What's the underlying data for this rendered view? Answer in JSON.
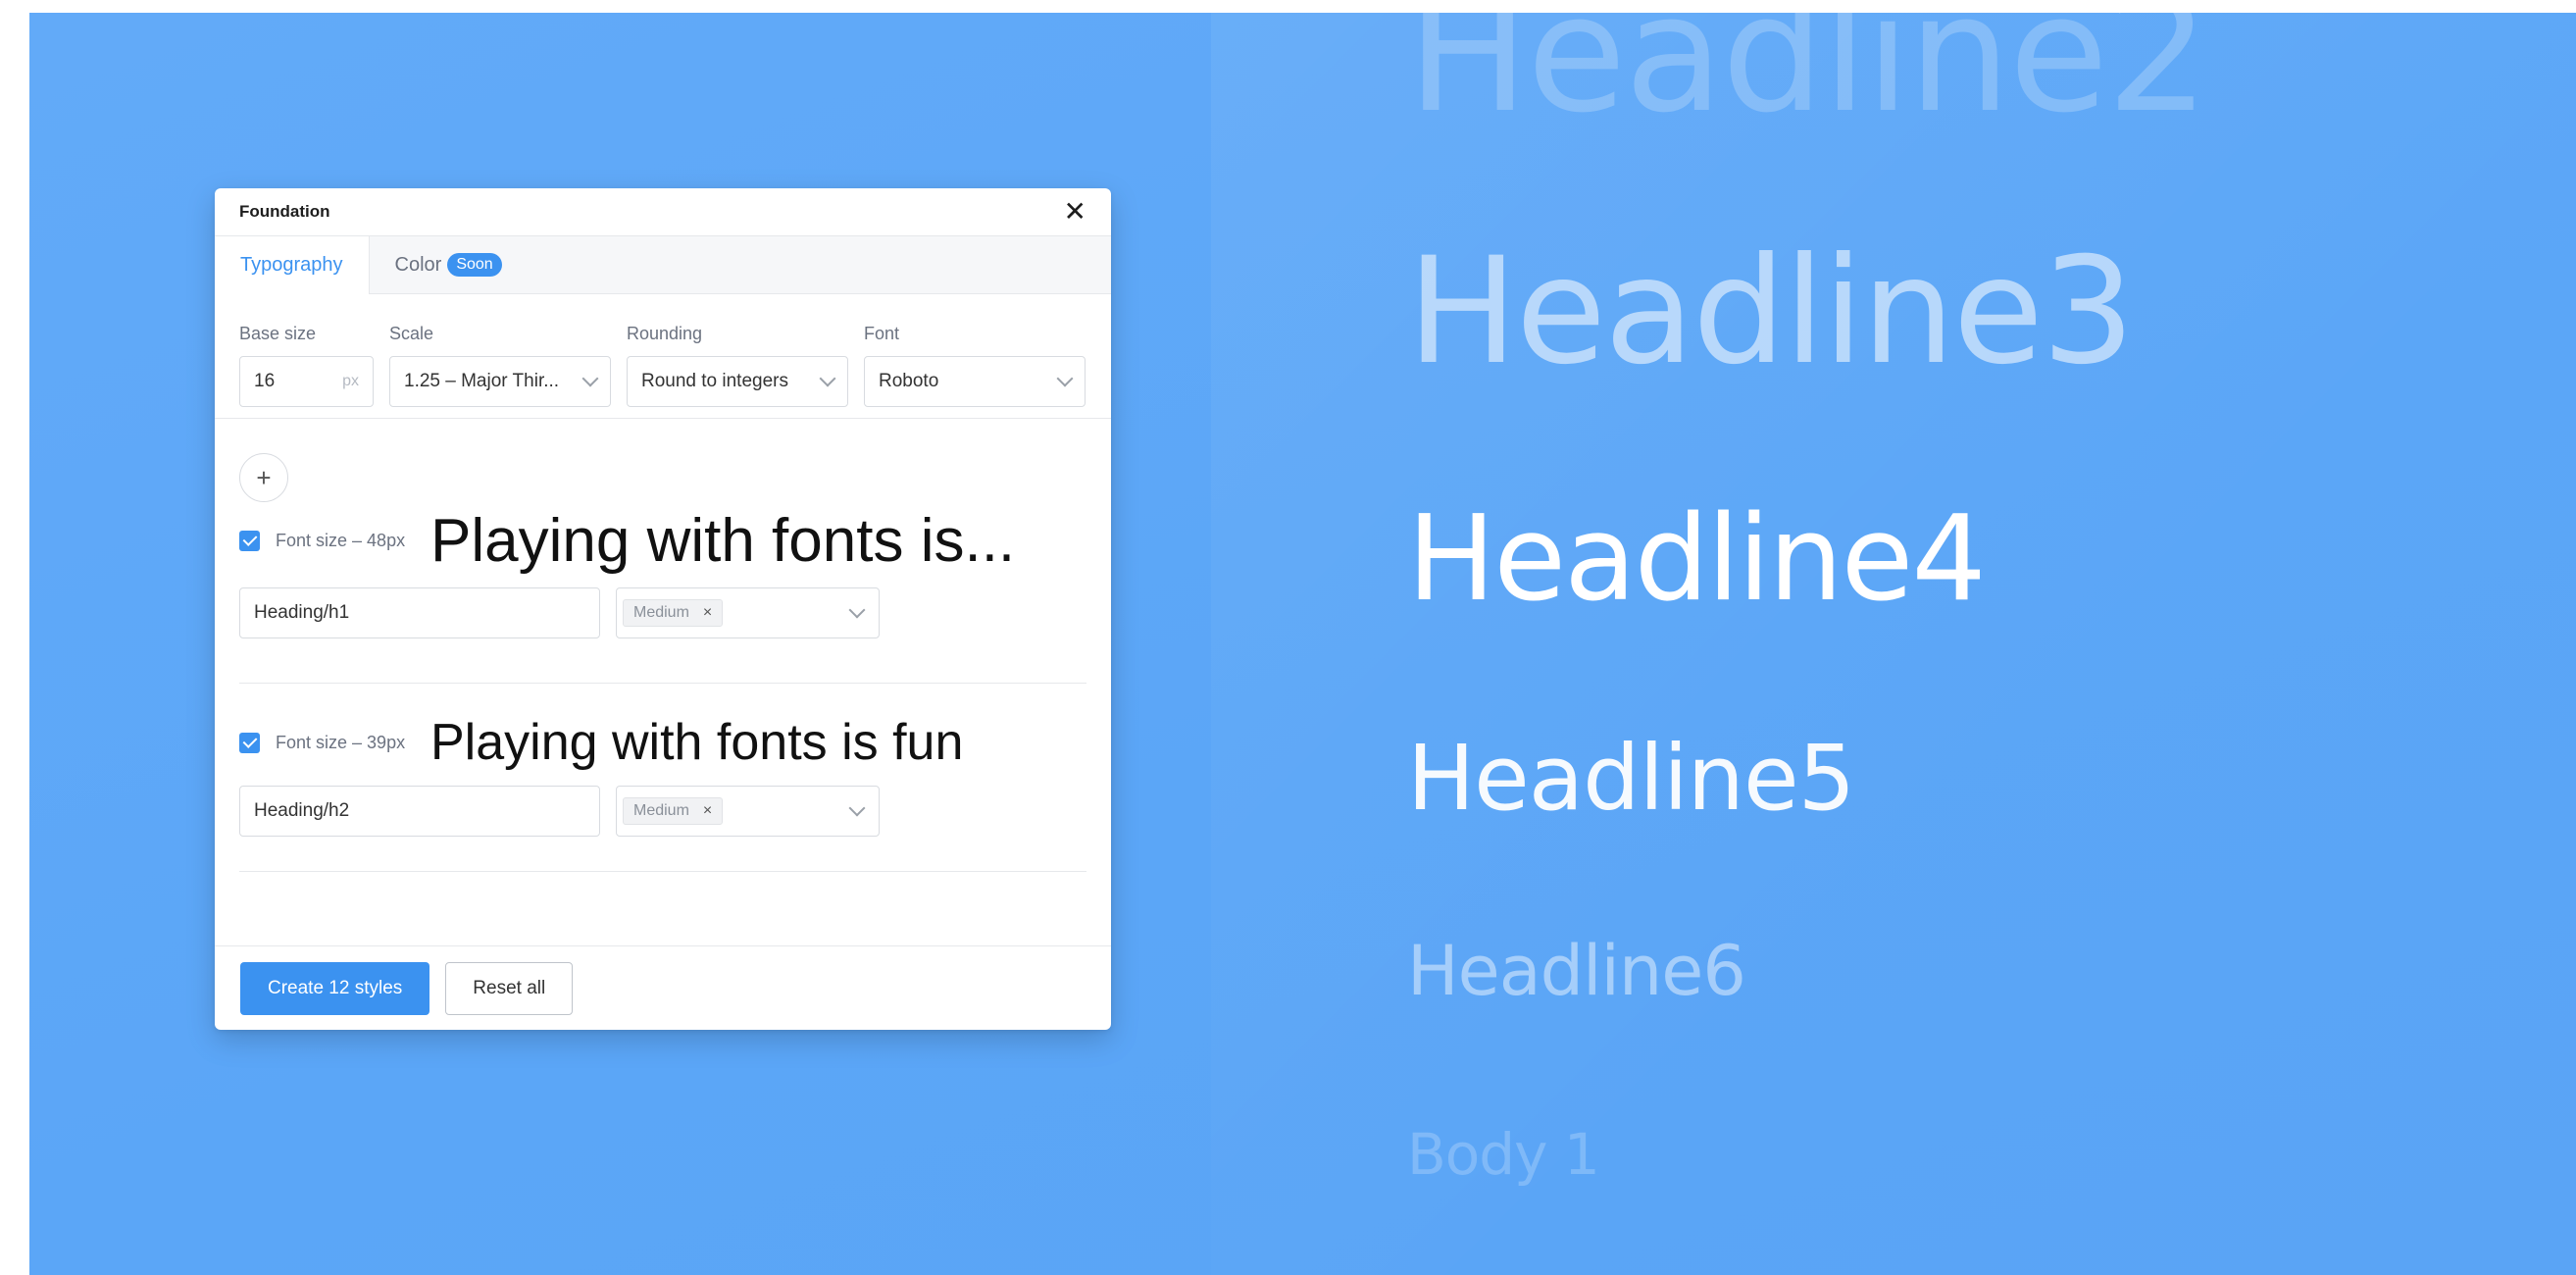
{
  "preview": {
    "headlines": [
      "Headline2",
      "Headline3",
      "Headline4",
      "Headline5",
      "Headline6",
      "Body 1"
    ]
  },
  "panel": {
    "title": "Foundation",
    "close_icon": "close-icon",
    "tabs": [
      {
        "label": "Typography",
        "active": true
      },
      {
        "label": "Color",
        "badge": "Soon",
        "active": false
      }
    ],
    "settings": {
      "base_size": {
        "label": "Base size",
        "value": "16",
        "suffix": "px"
      },
      "scale": {
        "label": "Scale",
        "value": "1.25 – Major Thir..."
      },
      "rounding": {
        "label": "Rounding",
        "value": "Round to integers"
      },
      "font": {
        "label": "Font",
        "value": "Roboto"
      }
    },
    "add_icon": "plus-icon",
    "add_symbol": "+",
    "rows": [
      {
        "checked": true,
        "size_label": "Font size – 48px",
        "sample": "Playing with fonts is...",
        "name": "Heading/h1",
        "weight": "Medium",
        "remove": "×"
      },
      {
        "checked": true,
        "size_label": "Font size – 39px",
        "sample": "Playing with fonts is fun",
        "name": "Heading/h2",
        "weight": "Medium",
        "remove": "×"
      }
    ],
    "footer": {
      "create_label": "Create 12 styles",
      "reset_label": "Reset all"
    }
  },
  "colors": {
    "background": "#5ba6f7",
    "accent": "#3b92f0"
  }
}
